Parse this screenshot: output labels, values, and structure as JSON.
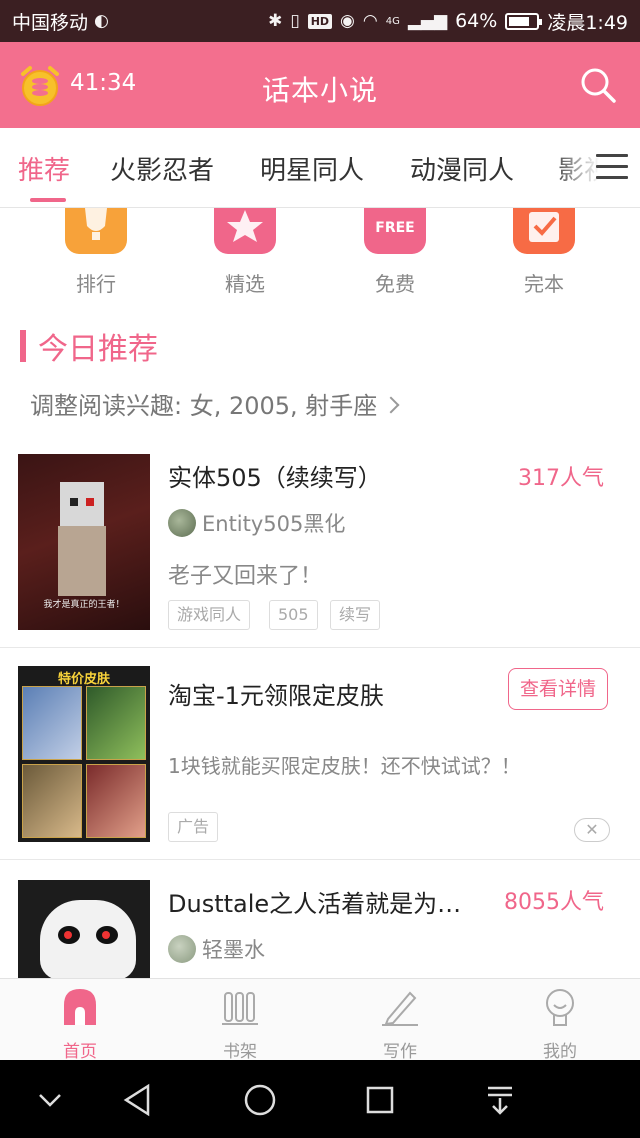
{
  "status_bar": {
    "carrier": "中国移动",
    "battery": "64%",
    "time": "凌晨1:49",
    "network": "4G",
    "hd_badge": "HD",
    "battery_level": 0.64
  },
  "header": {
    "timer": "41:34",
    "title": "话本小说",
    "alarm_icon": "alarm-clock-coin-icon",
    "search_icon": "search-icon",
    "accent_color": "#f36f8e"
  },
  "tabs": [
    {
      "label": "推荐",
      "active": true
    },
    {
      "label": "火影忍者",
      "active": false
    },
    {
      "label": "明星同人",
      "active": false
    },
    {
      "label": "动漫同人",
      "active": false
    },
    {
      "label": "影视",
      "active": false
    }
  ],
  "categories": [
    {
      "label": "排行",
      "icon": "trophy-icon",
      "color": "#f7a23a"
    },
    {
      "label": "精选",
      "icon": "star-icon",
      "color": "#f0668a"
    },
    {
      "label": "免费",
      "icon": "free-tag-icon",
      "color": "#f0668a",
      "badge": "FREE"
    },
    {
      "label": "完本",
      "icon": "check-calendar-icon",
      "color": "#f76b45"
    }
  ],
  "section": {
    "title": "今日推荐",
    "interest_text": "调整阅读兴趣: 女, 2005, 射手座"
  },
  "books": [
    {
      "title": "实体505（续续写）",
      "popularity": "317人气",
      "author": "Entity505黑化",
      "description": "老子又回来了！",
      "tags": [
        "游戏同人",
        "505",
        "续写"
      ],
      "cover_caption": "我才是真正的王者！"
    },
    {
      "title": "Dusttale之人活着就是为…",
      "popularity": "8055人气",
      "author": "轻墨水"
    }
  ],
  "ad": {
    "title": "淘宝-1元领限定皮肤",
    "description": "1块钱就能买限定皮肤！还不快试试？！",
    "tag": "广告",
    "button_label": "查看详情",
    "cover_header": "特价皮肤",
    "close_glyph": "✕"
  },
  "bottom_nav": [
    {
      "label": "首页",
      "icon": "home-icon",
      "active": true
    },
    {
      "label": "书架",
      "icon": "bookshelf-icon",
      "active": false
    },
    {
      "label": "写作",
      "icon": "pen-icon",
      "active": false
    },
    {
      "label": "我的",
      "icon": "profile-icon",
      "active": false
    }
  ]
}
